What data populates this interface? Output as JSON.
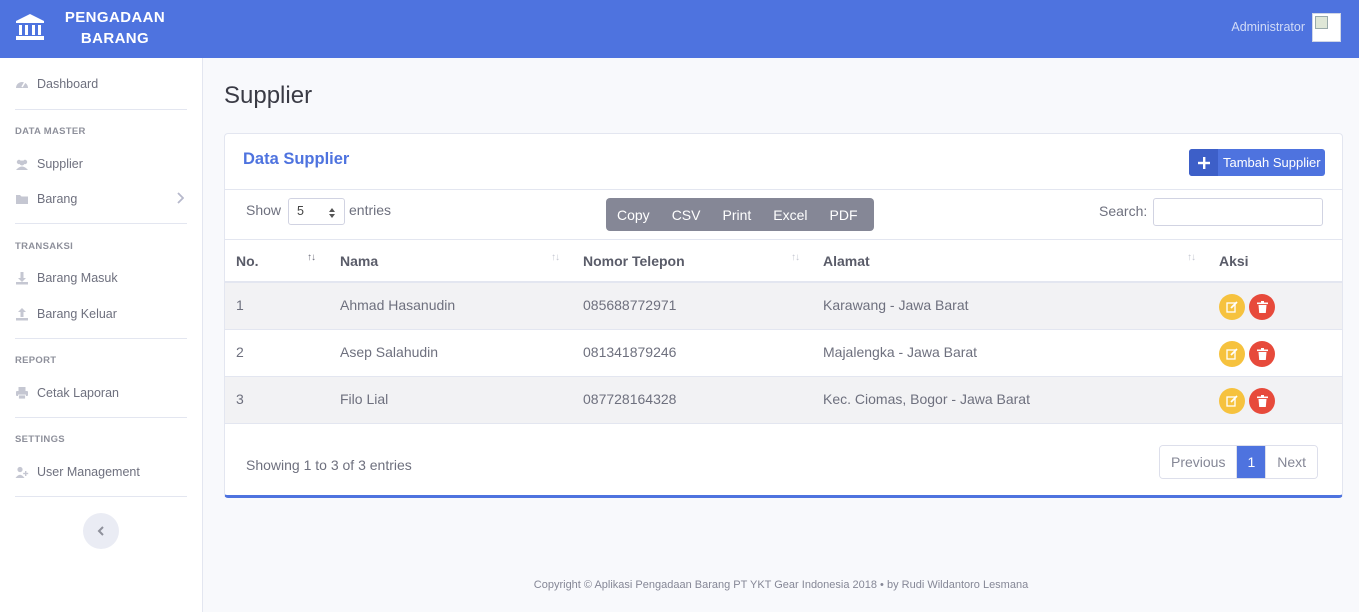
{
  "header": {
    "brand": "PENGADAAN BARANG",
    "user_name": "Administrator"
  },
  "sidebar": {
    "dashboard": "Dashboard",
    "sections": {
      "data_master": "DATA MASTER",
      "transaksi": "TRANSAKSI",
      "report": "REPORT",
      "settings": "SETTINGS"
    },
    "items": {
      "supplier": "Supplier",
      "barang": "Barang",
      "barang_masuk": "Barang Masuk",
      "barang_keluar": "Barang Keluar",
      "cetak_laporan": "Cetak Laporan",
      "user_management": "User Management"
    }
  },
  "page": {
    "title": "Supplier"
  },
  "card": {
    "title": "Data Supplier",
    "add_button": "Tambah Supplier"
  },
  "table_controls": {
    "show": "Show",
    "entries": "entries",
    "length_value": "5",
    "export_buttons": [
      "Copy",
      "CSV",
      "Print",
      "Excel",
      "PDF"
    ],
    "search_label": "Search:",
    "search_value": ""
  },
  "table": {
    "columns": [
      "No.",
      "Nama",
      "Nomor Telepon",
      "Alamat",
      "Aksi"
    ],
    "rows": [
      {
        "no": "1",
        "nama": "Ahmad Hasanudin",
        "telepon": "085688772971",
        "alamat": "Karawang - Jawa Barat"
      },
      {
        "no": "2",
        "nama": "Asep Salahudin",
        "telepon": "081341879246",
        "alamat": "Majalengka - Jawa Barat"
      },
      {
        "no": "3",
        "nama": "Filo Lial",
        "telepon": "087728164328",
        "alamat": "Kec. Ciomas, Bogor - Jawa Barat"
      }
    ]
  },
  "pagination": {
    "info": "Showing 1 to 3 of 3 entries",
    "previous": "Previous",
    "current": "1",
    "next": "Next"
  },
  "footer": {
    "text": "Copyright © Aplikasi Pengadaan Barang PT YKT Gear Indonesia 2018 • by Rudi Wildantoro Lesmana"
  },
  "colors": {
    "primary": "#4e73df",
    "warning": "#f6c23e",
    "danger": "#e74a3b",
    "secondary": "#858796"
  }
}
